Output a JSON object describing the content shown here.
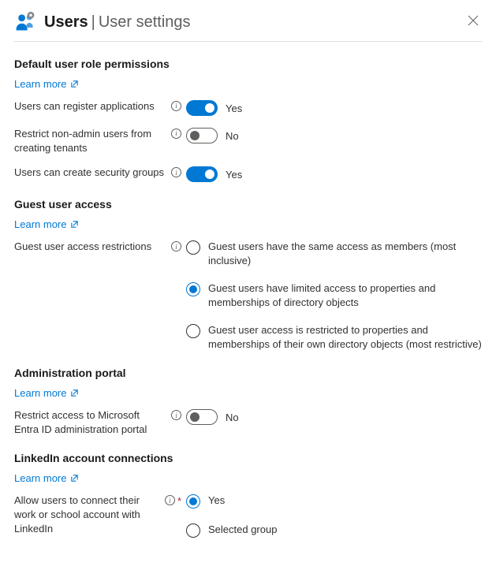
{
  "header": {
    "title": "Users",
    "separator": "|",
    "subtitle": "User settings"
  },
  "sections": {
    "defaultUser": {
      "heading": "Default user role permissions",
      "learnMore": "Learn more",
      "rows": {
        "registerApps": {
          "label": "Users can register applications",
          "value": "Yes"
        },
        "restrictTenants": {
          "label": "Restrict non-admin users from creating tenants",
          "value": "No"
        },
        "securityGroups": {
          "label": "Users can create security groups",
          "value": "Yes"
        }
      }
    },
    "guestAccess": {
      "heading": "Guest user access",
      "learnMore": "Learn more",
      "label": "Guest user access restrictions",
      "options": {
        "o1": "Guest users have the same access as members (most inclusive)",
        "o2": "Guest users have limited access to properties and memberships of directory objects",
        "o3": "Guest user access is restricted to properties and memberships of their own directory objects (most restrictive)"
      }
    },
    "adminPortal": {
      "heading": "Administration portal",
      "learnMore": "Learn more",
      "rows": {
        "restrict": {
          "label": "Restrict access to Microsoft Entra ID administration portal",
          "value": "No"
        }
      }
    },
    "linkedin": {
      "heading": "LinkedIn account connections",
      "learnMore": "Learn more",
      "label": "Allow users to connect their work or school account with LinkedIn",
      "options": {
        "o1": "Yes",
        "o2": "Selected group"
      }
    }
  }
}
